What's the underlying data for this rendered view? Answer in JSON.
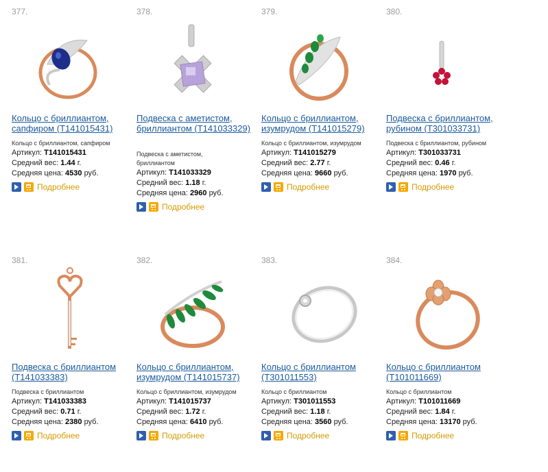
{
  "labels": {
    "article": "Артикул:",
    "weight": "Средний вес:",
    "price": "Средняя цена:",
    "more": "Подробнее"
  },
  "products": [
    {
      "num": "377.",
      "title": "Кольцо с бриллиантом, сапфиром (Т141015431)",
      "subtitle": "Кольцо с бриллиантом, сапфиром",
      "article": "Т141015431",
      "weight": "1.44",
      "weight_unit": "г.",
      "price": "4530",
      "price_unit": "руб.",
      "icon": "ring-sapphire-photo"
    },
    {
      "num": "378.",
      "title": "Подвеска с аметистом, бриллиантом (Т141033329)",
      "subtitle": "Подвеска с аметистом, бриллиантом",
      "article": "Т141033329",
      "weight": "1.18",
      "weight_unit": "г.",
      "price": "2960",
      "price_unit": "руб.",
      "icon": "pendant-amethyst-photo"
    },
    {
      "num": "379.",
      "title": "Кольцо с бриллиантом, изумрудом (Т141015279)",
      "subtitle": "Кольцо с бриллиантом, изумрудом",
      "article": "Т141015279",
      "weight": "2.77",
      "weight_unit": "г.",
      "price": "9660",
      "price_unit": "руб.",
      "icon": "ring-emerald-photo"
    },
    {
      "num": "380.",
      "title": "Подвеска с бриллиантом, рубином (Т301033731)",
      "subtitle": "Подвеска с бриллиантом, рубином",
      "article": "Т301033731",
      "weight": "0.46",
      "weight_unit": "г.",
      "price": "1970",
      "price_unit": "руб.",
      "icon": "pendant-ruby-photo"
    },
    {
      "num": "381.",
      "title": "Подвеска с бриллиантом (Т141033383)",
      "subtitle": "Подвеска с бриллиантом",
      "article": "Т141033383",
      "weight": "0.71",
      "weight_unit": "г.",
      "price": "2380",
      "price_unit": "руб.",
      "icon": "pendant-key-photo"
    },
    {
      "num": "382.",
      "title": "Кольцо с бриллиантом, изумрудом (Т141015737)",
      "subtitle": "Кольцо с бриллиантом, изумрудом",
      "article": "Т141015737",
      "weight": "1.72",
      "weight_unit": "г.",
      "price": "6410",
      "price_unit": "руб.",
      "icon": "ring-emerald-leaf-photo"
    },
    {
      "num": "383.",
      "title": "Кольцо с бриллиантом (Т301011553)",
      "subtitle": "Кольцо с бриллиантом",
      "article": "Т301011553",
      "weight": "1.18",
      "weight_unit": "г.",
      "price": "3560",
      "price_unit": "руб.",
      "icon": "ring-white-gold-photo"
    },
    {
      "num": "384.",
      "title": "Кольцо с бриллиантом (Т101011669)",
      "subtitle": "Кольцо с бриллиантом",
      "article": "Т101011669",
      "weight": "1.84",
      "weight_unit": "г.",
      "price": "13170",
      "price_unit": "руб.",
      "icon": "ring-flower-photo"
    }
  ],
  "colors": {
    "link": "#1a5a9c",
    "more": "#d59a00",
    "go_button": "#2f5fae",
    "cart_button": "#f5a800",
    "number": "#9a9a9a"
  }
}
